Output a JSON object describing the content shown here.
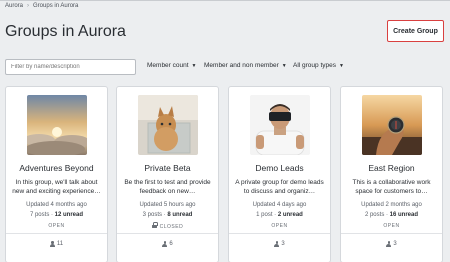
{
  "breadcrumb": {
    "root": "Aurora",
    "separator": "›",
    "current": "Groups in Aurora"
  },
  "page": {
    "title": "Groups in Aurora"
  },
  "toolbar": {
    "create_label": "Create Group",
    "filter_placeholder": "Filter by name/description",
    "dropdowns": [
      "Member count",
      "Member and non member",
      "All group types"
    ]
  },
  "colors": {
    "accent_border": "#d94040",
    "background": "#eceef0",
    "card": "#ffffff"
  },
  "groups": [
    {
      "name": "Adventures Beyond",
      "description": "In this group, we'll talk about new and exciting experience…",
      "updated": "Updated 4 months ago",
      "posts": "7 posts",
      "unread": "12 unread",
      "access": "OPEN",
      "members": "11",
      "image": "clouds-sunset"
    },
    {
      "name": "Private Beta",
      "description": "Be the first to test and provide feedback on new…",
      "updated": "Updated 5 hours ago",
      "posts": "3 posts",
      "unread": "8 unread",
      "access": "CLOSED",
      "members": "6",
      "image": "cat-in-glass-box"
    },
    {
      "name": "Demo Leads",
      "description": "A private group for demo leads to discuss and organiz…",
      "updated": "Updated 4 days ago",
      "posts": "1 post",
      "unread": "2 unread",
      "access": "OPEN",
      "members": "3",
      "image": "man-vr-headset"
    },
    {
      "name": "East Region",
      "description": "This is a collaborative work space for customers to…",
      "updated": "Updated 2 months ago",
      "posts": "2 posts",
      "unread": "16 unread",
      "access": "OPEN",
      "members": "3",
      "image": "compass-in-hand"
    }
  ]
}
